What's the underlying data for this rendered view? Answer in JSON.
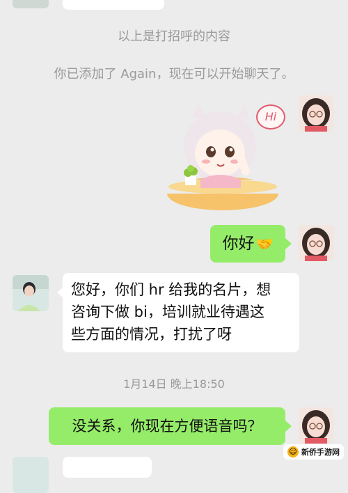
{
  "system": {
    "greeting_note": "以上是打招呼的内容",
    "added_note": "你已添加了 Again，现在可以开始聊天了。",
    "timestamp": "1月14日 晚上18:50"
  },
  "messages": [
    {
      "side": "right",
      "type": "sticker",
      "sticker_text": "Hi"
    },
    {
      "side": "right",
      "text": "你好",
      "emoji": "handshake"
    },
    {
      "side": "left",
      "line1": "您好，你们 hr 给我的名片，想",
      "line2": "咨询下做 bi，培训就业待遇这",
      "line3": "些方面的情况，打扰了呀"
    },
    {
      "side": "right",
      "text": "没关系，你现在方便语音吗？"
    }
  ],
  "colors": {
    "bg": "#ececec",
    "self_bubble": "#95ec69",
    "other_bubble": "#ffffff",
    "system_text": "#9a9a9a"
  },
  "watermark": {
    "text": "新侨手游网"
  }
}
